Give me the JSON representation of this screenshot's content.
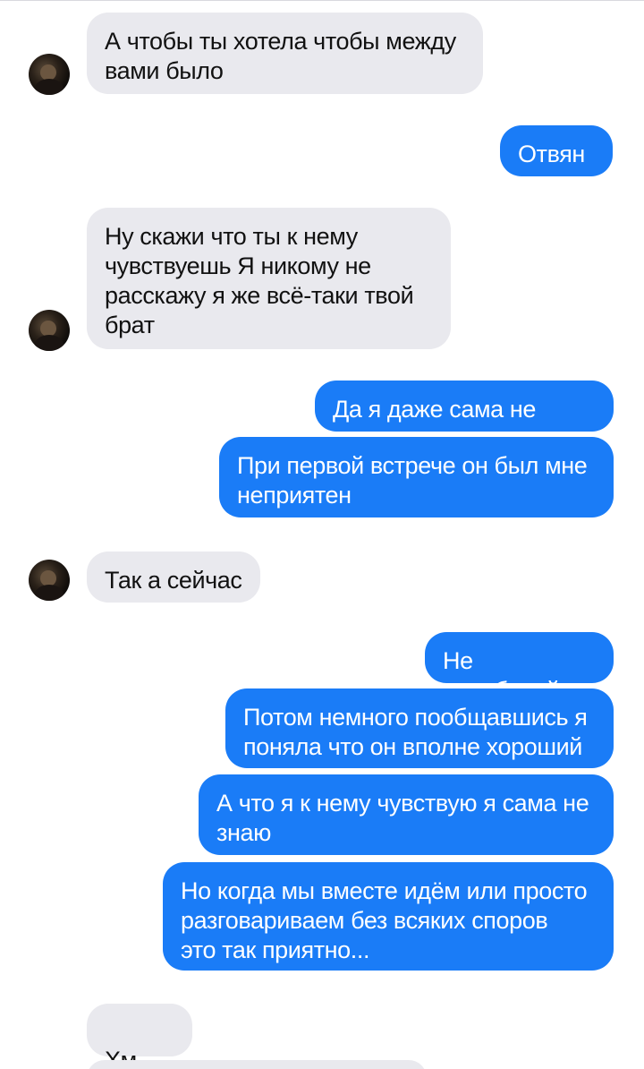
{
  "messages": [
    {
      "side": "in",
      "text": "А чтобы ты хотела чтобы между\nвами было"
    },
    {
      "side": "out",
      "text": "Отвянь"
    },
    {
      "side": "in",
      "text": "Ну скажи что ты к нему\nчувствуешь Я никому не\nрасскажу я же всё-таки твой\nбрат"
    },
    {
      "side": "out",
      "text": "Да я даже сама не знаю"
    },
    {
      "side": "out",
      "text": "При первой встрече он был мне\nнеприятен"
    },
    {
      "side": "in",
      "text": "Так а сейчас"
    },
    {
      "side": "out",
      "text": "Не перебивай"
    },
    {
      "side": "out",
      "text": "Потом немного пообщавшись я\nпоняла что он вполне хороший"
    },
    {
      "side": "out",
      "text": "А что я к нему чувствую я сама не\nзнаю"
    },
    {
      "side": "out",
      "text": "Но когда мы вместе идём или просто\nразговариваем без  всяких споров\nэто так приятно..."
    },
    {
      "side": "in",
      "text": "Хм",
      "emoji": "smirking-face-icon"
    }
  ],
  "colors": {
    "incoming_bubble": "#e9e9ee",
    "outgoing_bubble": "#1a7cf7",
    "incoming_text": "#111111",
    "outgoing_text": "#ffffff",
    "background": "#ffffff"
  }
}
